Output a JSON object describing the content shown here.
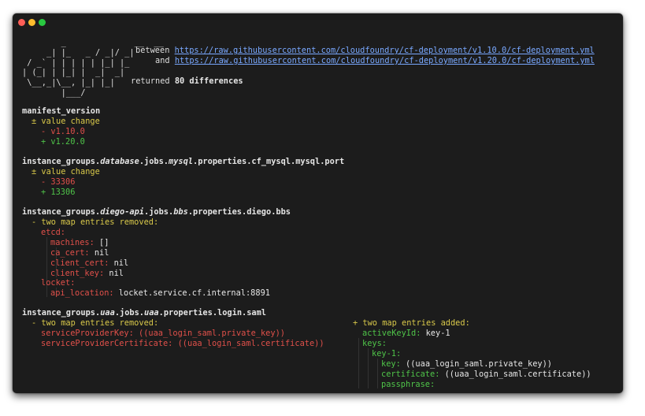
{
  "window": {
    "controls": [
      "close",
      "minimize",
      "zoom"
    ]
  },
  "header": {
    "ascii_logo": "        _              __  __\n     _| |_   _ / _|/ _|\n / _` | | | | | |_| |_\n| (_| | |_| |  _|  _|\n \\__,_|\\__, |_| |_|\n        |___/",
    "between_label": "between",
    "url_from": "https://raw.githubusercontent.com/cloudfoundry/cf-deployment/v1.10.0/cf-deployment.yml",
    "and_label": "and",
    "url_to": "https://raw.githubusercontent.com/cloudfoundry/cf-deployment/v1.20.0/cf-deployment.yml",
    "returned_label": "returned",
    "diff_count": "80 differences"
  },
  "diffs": [
    {
      "path": "manifest_version",
      "change_label": "± value change",
      "old": "- v1.10.0",
      "new": "+ v1.20.0"
    },
    {
      "path_parts": [
        "instance_groups.",
        "database",
        ".jobs.",
        "mysql",
        ".properties.cf_mysql.mysql.port"
      ],
      "change_label": "± value change",
      "old": "- 33306",
      "new": "+ 13306"
    },
    {
      "path_parts": [
        "instance_groups.",
        "diego-api",
        ".jobs.",
        "bbs",
        ".properties.diego.bbs"
      ],
      "change_label": "- two map entries removed:",
      "entries": {
        "etcd": "etcd:",
        "machines_key": "machines:",
        "machines_val": "[]",
        "ca_cert_key": "ca_cert:",
        "ca_cert_val": "nil",
        "client_cert_key": "client_cert:",
        "client_cert_val": "nil",
        "client_key_key": "client_key:",
        "client_key_val": "nil",
        "locket": "locket:",
        "api_location_key": "api_location:",
        "api_location_val": "locket.service.cf.internal:8891"
      }
    },
    {
      "path_parts": [
        "instance_groups.",
        "uaa",
        ".jobs.",
        "uaa",
        ".properties.login.saml"
      ],
      "removed_label": "- two map entries removed:",
      "removed": {
        "spk_key": "serviceProviderKey:",
        "spk_val": "((uaa_login_saml.private_key))",
        "spc_key": "serviceProviderCertificate:",
        "spc_val": "((uaa_login_saml.certificate))"
      },
      "added_label": "+ two map entries added:",
      "added": {
        "active_key": "activeKeyId:",
        "active_val": "key-1",
        "keys": "keys:",
        "key1": "key-1:",
        "key_key": "key:",
        "key_val": "((uaa_login_saml.private_key))",
        "cert_key": "certificate:",
        "cert_val": "((uaa_login_saml.certificate))",
        "pass_key": "passphrase:"
      }
    }
  ]
}
